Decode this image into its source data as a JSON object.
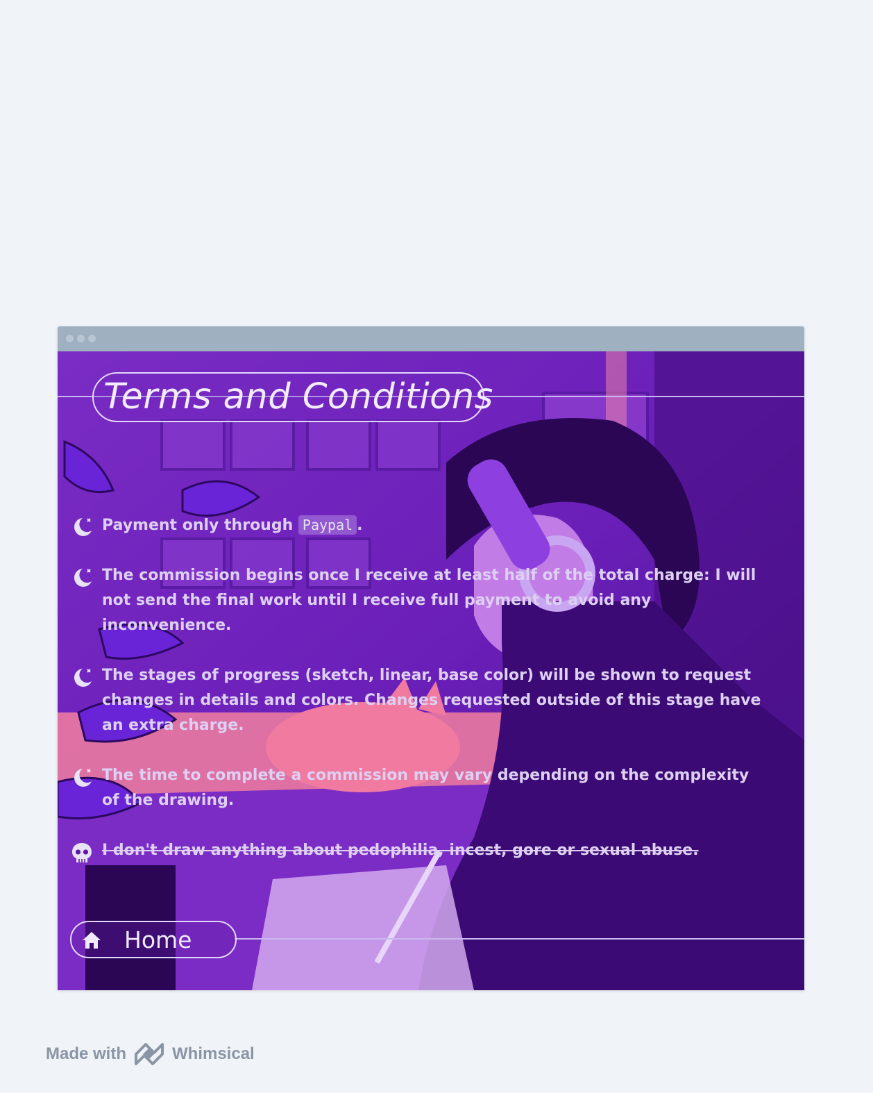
{
  "page": {
    "title": "Terms and Conditions",
    "home_label": "Home"
  },
  "terms": [
    {
      "icon": "moon-icon",
      "text_before": "Payment only through ",
      "code": "Paypal",
      "text_after": "."
    },
    {
      "icon": "moon-icon",
      "text": "The commission begins once I receive at least half of the total charge: I will not send the final work until I receive full payment to avoid any inconvenience."
    },
    {
      "icon": "moon-icon",
      "text": "The stages of progress (sketch, linear, base color) will be shown to request changes in details and colors. Changes requested outside of this stage have an extra charge."
    },
    {
      "icon": "moon-icon",
      "text": "The time to complete a commission may vary depending on the complexity of the drawing."
    },
    {
      "icon": "skull-icon",
      "text": "I don't draw anything about pedophilia, incest, gore or sexual abuse.",
      "strikethrough": true
    }
  ],
  "footer": {
    "made_with": "Made with",
    "brand": "Whimsical"
  },
  "colors": {
    "accent_purple": "#5e18a8",
    "pink": "#f07aa8",
    "outline": "#e3d8ff"
  }
}
